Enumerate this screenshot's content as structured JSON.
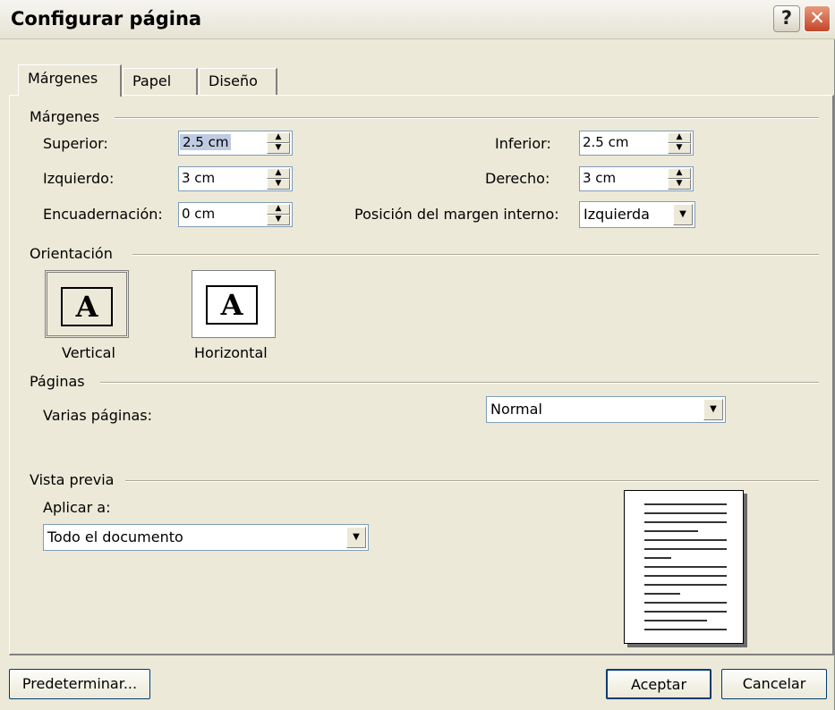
{
  "title": "Configurar página",
  "tabs": [
    "Márgenes",
    "Papel",
    "Diseño"
  ],
  "margins": {
    "group": "Márgenes",
    "superior": "Superior:",
    "superior_value": "2.5 cm",
    "izquierdo": "Izquierdo:",
    "izquierdo_value": "3 cm",
    "encuadernacion": "Encuadernación:",
    "encuadernacion_value": "0 cm",
    "inferior": "Inferior:",
    "inferior_value": "2.5 cm",
    "derecho": "Derecho:",
    "derecho_value": "3 cm",
    "posicion": "Posición del margen interno:",
    "posicion_value": "Izquierda"
  },
  "orientation": {
    "group": "Orientación",
    "icon_letter": "A",
    "vertical": "Vertical",
    "horizontal": "Horizontal"
  },
  "pages": {
    "group": "Páginas",
    "varias": "Varias páginas:",
    "varias_value": "Normal"
  },
  "preview": {
    "group": "Vista previa",
    "aplicar": "Aplicar a:",
    "aplicar_value": "Todo el documento"
  },
  "buttons": {
    "default": "Predeterminar...",
    "ok": "Aceptar",
    "cancel": "Cancelar"
  },
  "titlebar": {
    "help": "?",
    "close": "✕"
  }
}
